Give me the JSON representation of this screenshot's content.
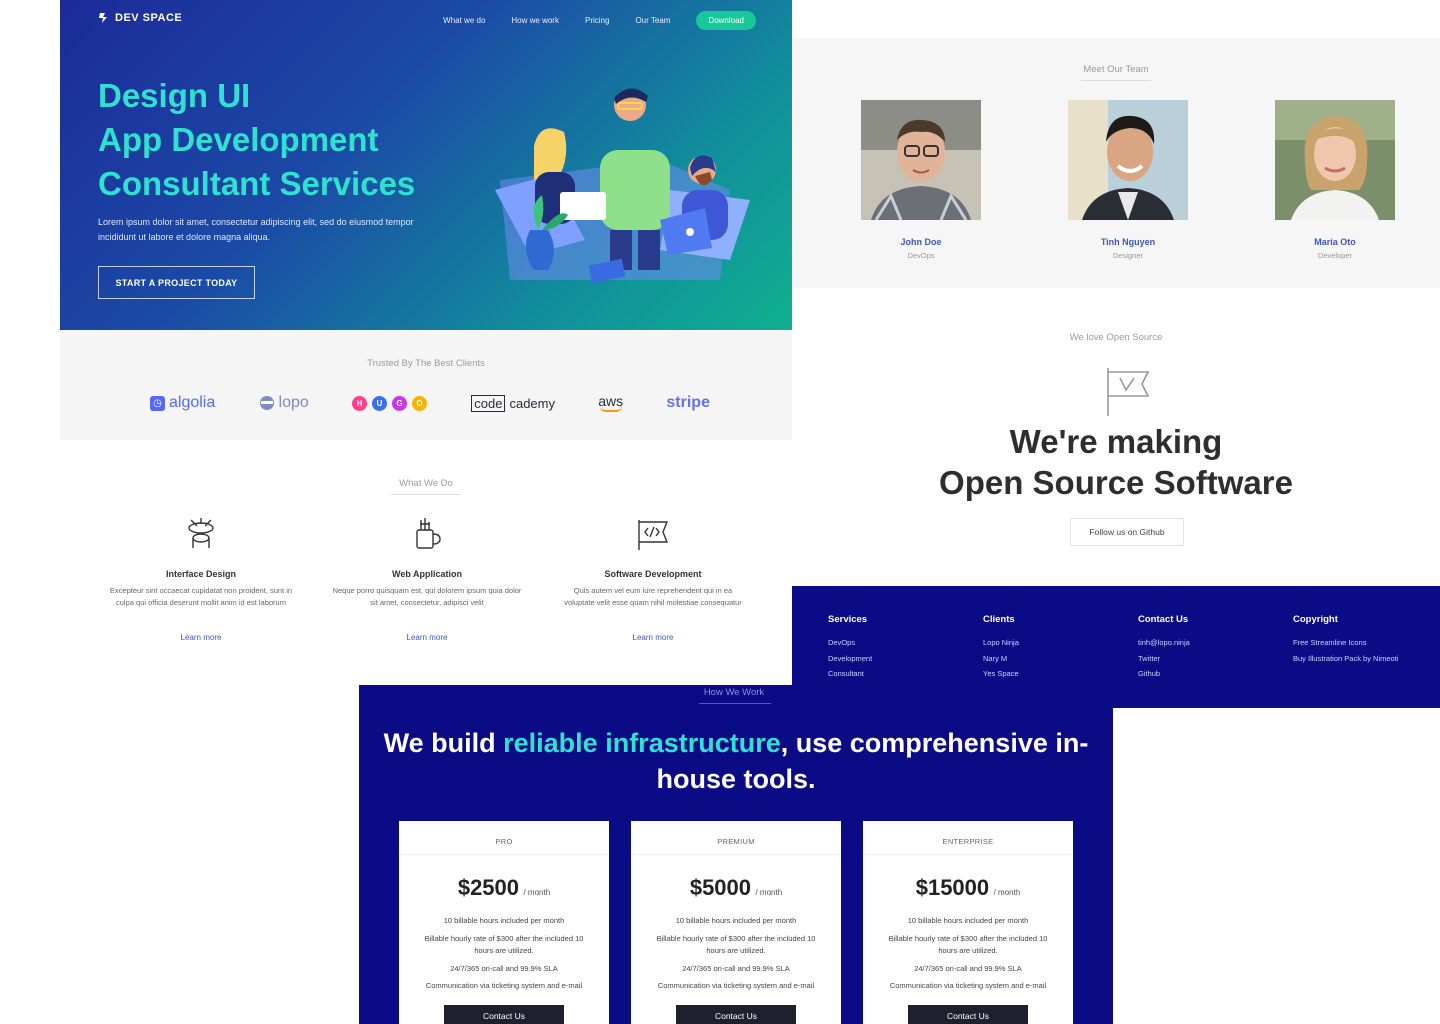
{
  "hero": {
    "brand": "DEV SPACE",
    "nav": [
      "What we do",
      "How we work",
      "Pricing",
      "Our Team"
    ],
    "nav_download": "Download",
    "title_lines": [
      "Design UI",
      "App Development",
      "Consultant Services"
    ],
    "subtitle": "Lorem ipsum dolor sit amet, consectetur adipiscing elit, sed do eiusmod tempor incididunt ut labore et dolore magna aliqua.",
    "cta": "START A PROJECT TODAY"
  },
  "clients": {
    "label": "Trusted By The Best Clients",
    "logos": {
      "algolia": "algolia",
      "lopo": "lopo",
      "hugo": [
        "H",
        "U",
        "G",
        "O"
      ],
      "code": "code",
      "cademy": "cademy",
      "aws": "aws",
      "stripe": "stripe"
    },
    "hugo_colors": [
      "#ff4088",
      "#3c6ff0",
      "#c837e0",
      "#ffb100"
    ]
  },
  "services": {
    "label": "What We Do",
    "items": [
      {
        "title": "Interface Design",
        "desc": "Excepteur sint occaecat cupidatat non proident, sunt in culpa qui officia deserunt mollit anim id est laborum",
        "link": "Learn more",
        "icon": "interface-design-icon"
      },
      {
        "title": "Web Application",
        "desc": "Neque porro quisquam est, qui dolorem ipsum quia dolor sit amet, consectetur, adipisci velit",
        "link": "Learn more",
        "icon": "web-application-icon"
      },
      {
        "title": "Software Development",
        "desc": "Quis autem vel eum iure reprehenderit qui in ea voluptate velit esse quam nihil molestiae consequatur",
        "link": "Learn more",
        "icon": "code-flag-icon"
      }
    ]
  },
  "team": {
    "label": "Meet Our Team",
    "members": [
      {
        "name": "John Doe",
        "role": "DevOps"
      },
      {
        "name": "Tinh Nguyen",
        "role": "Designer"
      },
      {
        "name": "Maria Oto",
        "role": "Developer"
      }
    ]
  },
  "oss": {
    "label": "We love Open Source",
    "title_lines": [
      "We're making",
      "Open Source Software"
    ],
    "button": "Follow us on Github"
  },
  "footer": {
    "columns": [
      {
        "heading": "Services",
        "links": [
          "DevOps",
          "Development",
          "Consultant"
        ]
      },
      {
        "heading": "Clients",
        "links": [
          "Lopo Ninja",
          "Nary M",
          "Yes Space"
        ]
      },
      {
        "heading": "Contact Us",
        "links": [
          "tinh@lopo.ninja",
          "Twitter",
          "Github"
        ]
      },
      {
        "heading": "Copyright",
        "links": [
          "Free Streamline Icons",
          "Buy Illustration Pack by Nimeoti"
        ]
      }
    ]
  },
  "pricing": {
    "label": "How We Work",
    "title_pre": "We build ",
    "title_highlight": "reliable infrastructure",
    "title_post": ", use comprehensive in-house tools.",
    "plans": [
      {
        "tier": "PRO",
        "price": "$2500",
        "period": "/ month",
        "features": [
          "10 billable hours included per month",
          "Billable hourly rate of $300 after the included 10 hours are utilized.",
          "24/7/365 on-call and 99.9% SLA",
          "Communication via ticketing system and e-mail"
        ],
        "button": "Contact Us"
      },
      {
        "tier": "PREMIUM",
        "price": "$5000",
        "period": "/ month",
        "features": [
          "10 billable hours included per month",
          "Billable hourly rate of $300 after the included 10 hours are utilized.",
          "24/7/365 on-call and 99.9% SLA",
          "Communication via ticketing system and e-mail"
        ],
        "button": "Contact Us"
      },
      {
        "tier": "ENTERPRISE",
        "price": "$15000",
        "period": "/ month",
        "features": [
          "10 billable hours included per month",
          "Billable hourly rate of $300 after the included 10 hours are utilized.",
          "24/7/365 on-call and 99.9% SLA",
          "Communication via ticketing system and e-mail"
        ],
        "button": "Contact Us"
      }
    ]
  }
}
